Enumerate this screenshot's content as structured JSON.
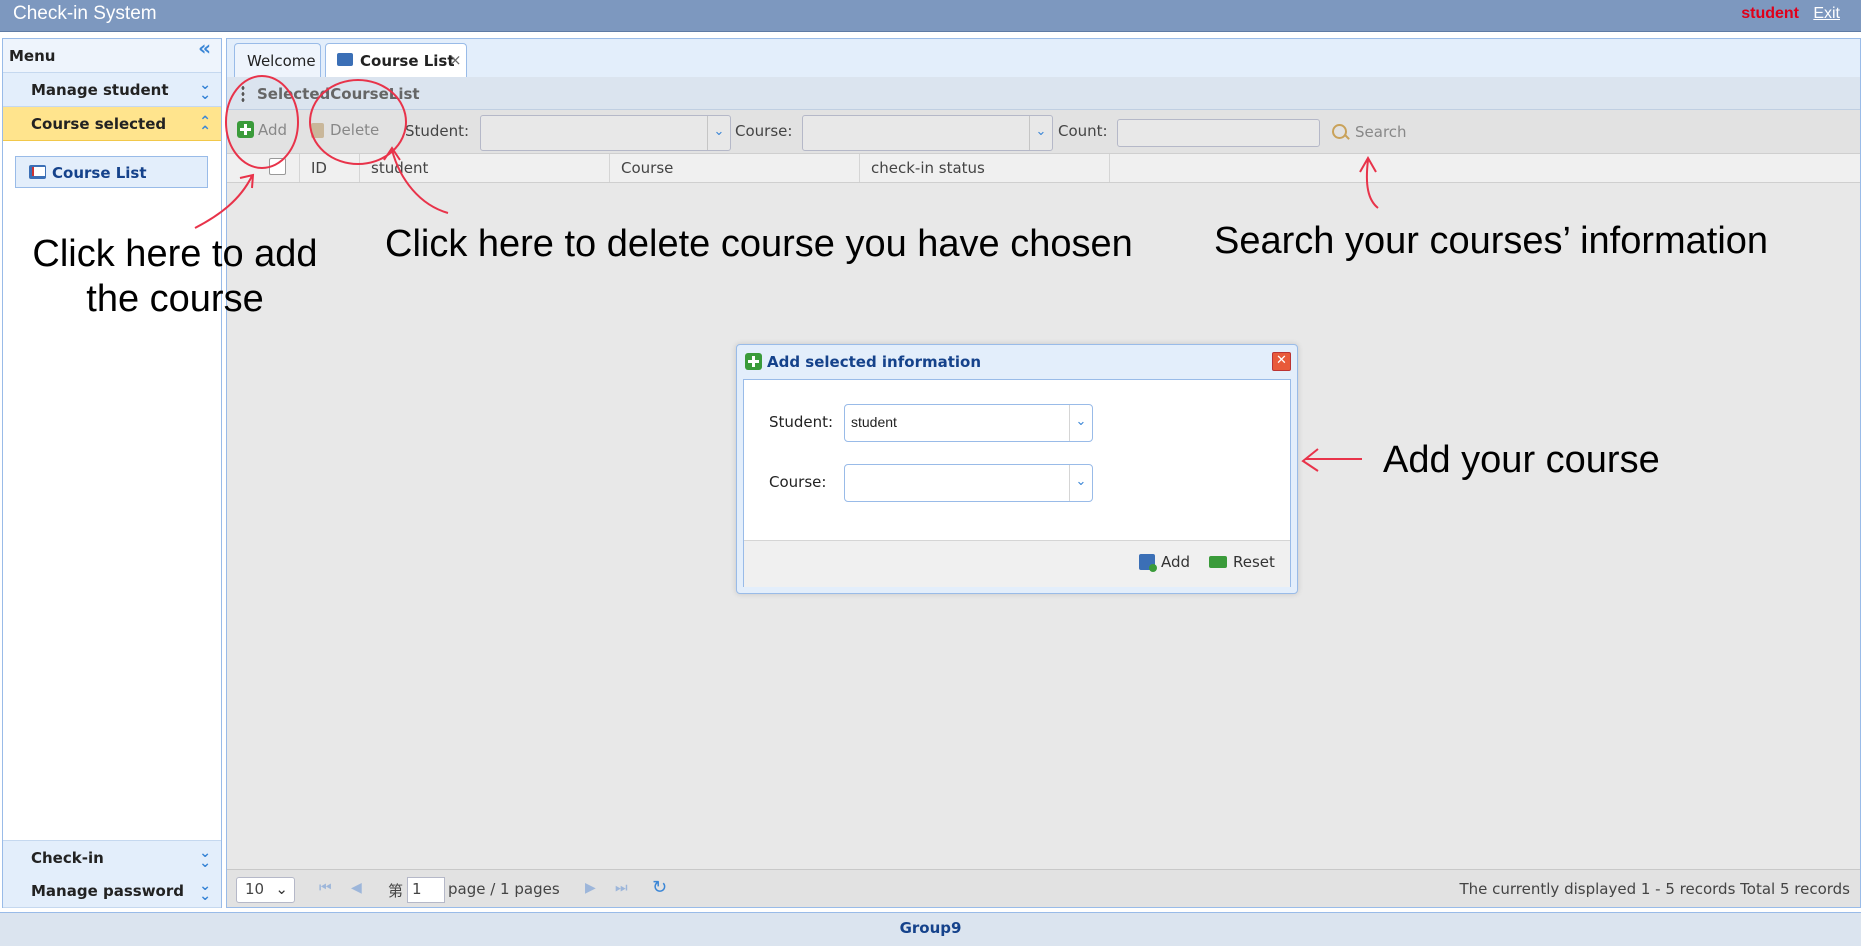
{
  "header": {
    "title": "Check-in System",
    "user": "student",
    "exit": "Exit"
  },
  "sidebar": {
    "menu_title": "Menu",
    "sections": [
      "Manage student",
      "Course selected",
      "Check-in",
      "Manage password"
    ],
    "active_item": "Course List"
  },
  "tabs": [
    "Welcome",
    "Course List"
  ],
  "tab_close": "×",
  "grid": {
    "title": "SelectedCourseList",
    "toolbar": {
      "add": "Add",
      "delete": "Delete",
      "student_label": "Student:",
      "course_label": "Course:",
      "count_label": "Count:",
      "search": "Search"
    },
    "columns": [
      "ID",
      "student",
      "Course",
      "check-in status"
    ]
  },
  "pager": {
    "page_size": "10",
    "page_prefix": "第",
    "page_input": "1",
    "page_suffix": "page / 1 pages",
    "status": "The currently displayed 1 - 5 records Total 5 records"
  },
  "dialog": {
    "title": "Add selected information",
    "student_label": "Student:",
    "student_value": "student",
    "course_label": "Course:",
    "course_value": "",
    "add_button": "Add",
    "reset_button": "Reset"
  },
  "footer": {
    "text": "Group9"
  },
  "annotations": {
    "add_hint": "Click here to add the course",
    "delete_hint": "Click here to delete course you have chosen",
    "search_hint": "Search your courses’ information",
    "dialog_hint": "Add your course",
    "mark_color": "#e8334a"
  }
}
